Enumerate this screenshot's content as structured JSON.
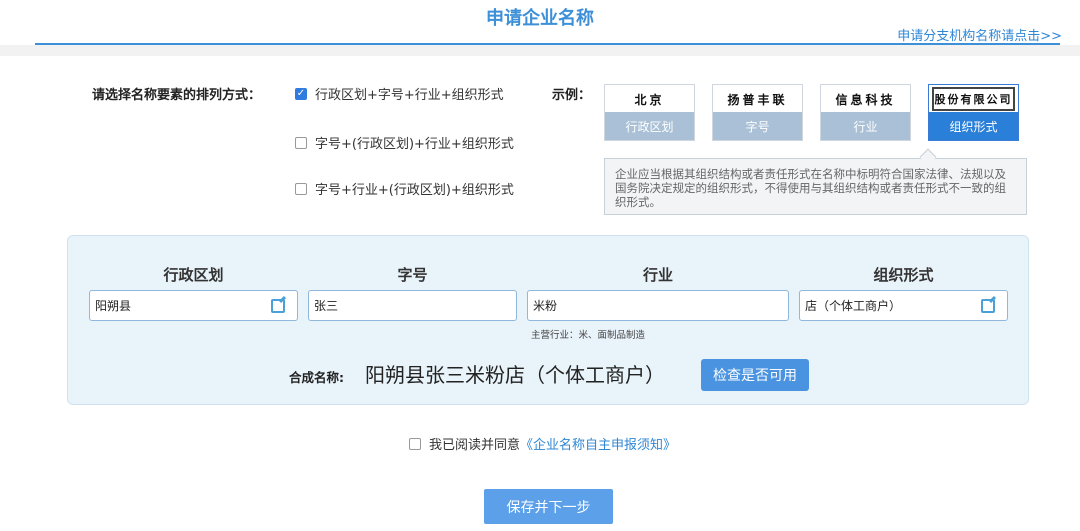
{
  "header": {
    "title": "申请企业名称",
    "branch_link": "申请分支机构名称请点击>>"
  },
  "order": {
    "label": "请选择名称要素的排列方式：",
    "options": [
      {
        "label": "行政区划+字号+行业+组织形式",
        "checked": true
      },
      {
        "label": "字号+(行政区划)+行业+组织形式",
        "checked": false
      },
      {
        "label": "字号+行业+(行政区划)+组织形式",
        "checked": false
      }
    ]
  },
  "example": {
    "label": "示例：",
    "cards": [
      {
        "seal": "北京",
        "caption": "行政区划"
      },
      {
        "seal": "扬普丰联",
        "caption": "字号"
      },
      {
        "seal": "信息科技",
        "caption": "行业"
      },
      {
        "seal": "股份有限公司",
        "caption": "组织形式",
        "active": true
      }
    ],
    "tip": "企业应当根据其组织结构或者责任形式在名称中标明符合国家法律、法规以及国务院决定规定的组织形式，不得使用与其组织结构或者责任形式不一致的组织形式。"
  },
  "form": {
    "headers": [
      "行政区划",
      "字号",
      "行业",
      "组织形式"
    ],
    "region_value": "阳朔县",
    "brand_value": "张三",
    "industry_value": "米粉",
    "org_form_value": "店（个体工商户）",
    "industry_hint": "主营行业：米、面制品制造",
    "combined_label": "合成名称:",
    "combined_name": "阳朔县张三米粉店（个体工商户）",
    "check_button": "检查是否可用"
  },
  "agreement": {
    "checked": false,
    "prefix": "我已阅读并同意",
    "link": "《企业名称自主申报须知》"
  },
  "footer": {
    "next_button": "保存并下一步"
  },
  "colors": {
    "accent": "#3d8fd8",
    "panel_bg": "#e8f3fa",
    "button": "#4a93e0"
  }
}
